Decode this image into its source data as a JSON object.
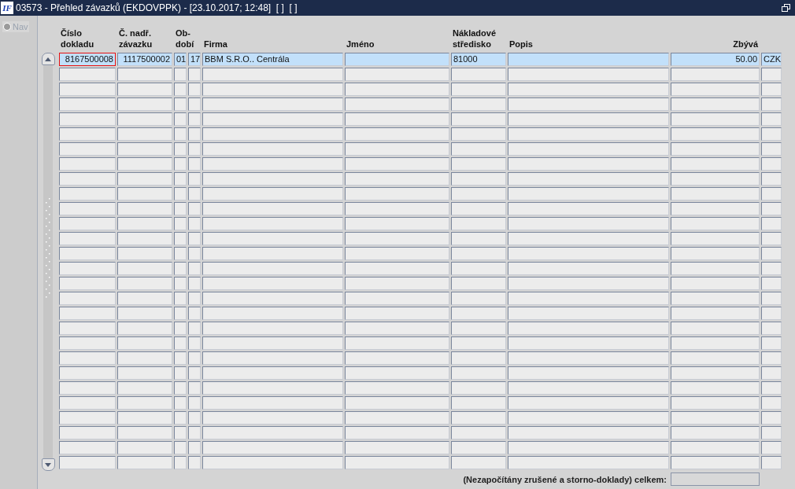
{
  "window": {
    "logo": "IF",
    "title": "03573 - Přehled závazků (EKDOVPPK) - [23.10.2017; 12:48]  [ ]  [ ]"
  },
  "sidebar": {
    "nav": {
      "label": "Nav",
      "checked": false,
      "disabled": true
    }
  },
  "table": {
    "columns": [
      {
        "lines": [
          "Číslo",
          "dokladu"
        ]
      },
      {
        "lines": [
          "Č. nadř.",
          "závazku"
        ]
      },
      {
        "lines": [
          "Ob-",
          "dobí"
        ]
      },
      {
        "lines": [
          "Firma"
        ]
      },
      {
        "lines": [
          "Jméno"
        ]
      },
      {
        "lines": [
          "Nákladové",
          "středisko"
        ]
      },
      {
        "lines": [
          "Popis"
        ]
      },
      {
        "lines": [
          "Zbývá"
        ]
      }
    ],
    "rows": [
      {
        "selected": true,
        "cells": [
          {
            "text": "8167500008",
            "focused": true
          },
          {
            "text": "1117500002",
            "focused": false
          },
          {
            "text": "01",
            "focused": false
          },
          {
            "text": "17",
            "focused": false
          },
          {
            "text": "BBM S.R.O.. Centrála",
            "focused": false
          },
          {
            "focused": false
          },
          {
            "text": "81000",
            "focused": false
          },
          {
            "focused": false
          },
          {
            "text": "50.00",
            "focused": false
          },
          {
            "text": "CZK",
            "focused": false
          }
        ]
      },
      {
        "selected": false
      },
      {
        "selected": false
      },
      {
        "selected": false
      },
      {
        "selected": false
      },
      {
        "selected": false
      },
      {
        "selected": false
      },
      {
        "selected": false
      },
      {
        "selected": false
      },
      {
        "selected": false
      },
      {
        "selected": false
      },
      {
        "selected": false
      },
      {
        "selected": false
      },
      {
        "selected": false
      },
      {
        "selected": false
      },
      {
        "selected": false
      },
      {
        "selected": false
      },
      {
        "selected": false
      },
      {
        "selected": false
      },
      {
        "selected": false
      },
      {
        "selected": false
      },
      {
        "selected": false
      },
      {
        "selected": false
      },
      {
        "selected": false
      },
      {
        "selected": false
      },
      {
        "selected": false
      },
      {
        "selected": false
      },
      {
        "selected": false
      }
    ]
  },
  "footer": {
    "label": "(Nezapočítány zrušené a storno-doklady) celkem:"
  }
}
